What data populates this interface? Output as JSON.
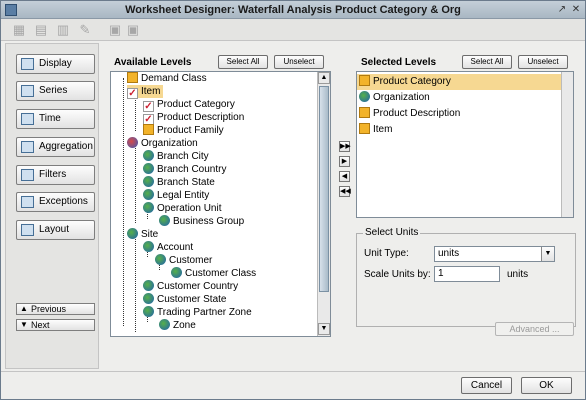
{
  "window": {
    "title": "Worksheet Designer: Waterfall Analysis Product Category & Org"
  },
  "toolbar": {
    "icons": [
      "new-icon",
      "copy-icon",
      "paste-icon",
      "edit-icon",
      "export-icon",
      "import-icon"
    ]
  },
  "nav": {
    "items": [
      {
        "label": "Display"
      },
      {
        "label": "Series"
      },
      {
        "label": "Time"
      },
      {
        "label": "Aggregation"
      },
      {
        "label": "Filters"
      },
      {
        "label": "Exceptions"
      },
      {
        "label": "Layout"
      }
    ],
    "previous": "Previous",
    "next": "Next"
  },
  "available": {
    "title": "Available Levels",
    "select_all": "Select All",
    "unselect": "Unselect",
    "tree": [
      {
        "label": "Demand Class",
        "icon": "cube-icon"
      },
      {
        "label": "Item",
        "icon": "check-icon"
      },
      {
        "label": "Product Category",
        "icon": "check-icon"
      },
      {
        "label": "Product Description",
        "icon": "check-icon"
      },
      {
        "label": "Product Family",
        "icon": "cube-icon"
      },
      {
        "label": "Organization",
        "icon": "org-globe-icon"
      },
      {
        "label": "Branch City",
        "icon": "globe-icon"
      },
      {
        "label": "Branch Country",
        "icon": "globe-icon"
      },
      {
        "label": "Branch State",
        "icon": "globe-icon"
      },
      {
        "label": "Legal Entity",
        "icon": "globe-icon"
      },
      {
        "label": "Operation Unit",
        "icon": "globe-icon"
      },
      {
        "label": "Business Group",
        "icon": "globe-icon"
      },
      {
        "label": "Site",
        "icon": "globe-icon"
      },
      {
        "label": "Account",
        "icon": "globe-icon"
      },
      {
        "label": "Customer",
        "icon": "globe-icon"
      },
      {
        "label": "Customer Class",
        "icon": "globe-icon"
      },
      {
        "label": "Customer Country",
        "icon": "globe-icon"
      },
      {
        "label": "Customer State",
        "icon": "globe-icon"
      },
      {
        "label": "Trading Partner Zone",
        "icon": "globe-icon"
      },
      {
        "label": "Zone",
        "icon": "globe-icon"
      }
    ]
  },
  "selected": {
    "title": "Selected Levels",
    "select_all": "Select All",
    "unselect": "Unselect",
    "items": [
      {
        "label": "Product Category",
        "icon": "cube-icon",
        "selected": true
      },
      {
        "label": "Organization",
        "icon": "globe-icon",
        "selected": false
      },
      {
        "label": "Product Description",
        "icon": "cube-icon",
        "selected": false
      },
      {
        "label": "Item",
        "icon": "cube-icon",
        "selected": false
      }
    ]
  },
  "units": {
    "legend": "Select Units",
    "unit_type_label": "Unit Type:",
    "unit_type_value": "units",
    "scale_label": "Scale Units by:",
    "scale_value": "1",
    "scale_suffix": "units"
  },
  "advanced": "Advanced ...",
  "footer": {
    "cancel": "Cancel",
    "ok": "OK"
  }
}
